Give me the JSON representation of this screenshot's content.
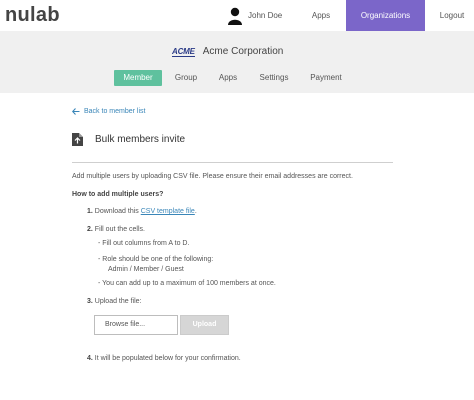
{
  "header": {
    "logo_text": "nulab",
    "user_name": "John Doe",
    "nav": {
      "apps": "Apps",
      "organizations": "Organizations",
      "logout": "Logout"
    }
  },
  "organization": {
    "logo_text": "ACME",
    "name": "Acme Corporation",
    "tabs": [
      {
        "label": "Member",
        "active": true
      },
      {
        "label": "Group",
        "active": false
      },
      {
        "label": "Apps",
        "active": false
      },
      {
        "label": "Settings",
        "active": false
      },
      {
        "label": "Payment",
        "active": false
      }
    ]
  },
  "page": {
    "back_link": "Back to member list",
    "title": "Bulk members invite",
    "intro": "Add multiple users by uploading CSV file. Please ensure their email addresses are correct.",
    "howto_heading": "How to add multiple users?",
    "steps": {
      "s1_num": "1.",
      "s1_prefix": "Download this ",
      "s1_link": "CSV template file",
      "s1_suffix": ".",
      "s2_num": "2.",
      "s2_text": "Fill out the cells.",
      "s2_bullets": [
        "Fill out columns from A to D.",
        "Role should be one of the following:",
        "Admin / Member / Guest",
        "You can add up to a maximum of 100 members at once."
      ],
      "s3_num": "3.",
      "s3_text": "Upload the file:",
      "s4_num": "4.",
      "s4_text": "It will be populated below for your confirmation."
    },
    "browse_label": "Browse file...",
    "upload_label": "Upload"
  },
  "colors": {
    "accent_purple": "#7b66c9",
    "tab_active_green": "#5fc19e",
    "link_blue": "#3a86b8"
  }
}
